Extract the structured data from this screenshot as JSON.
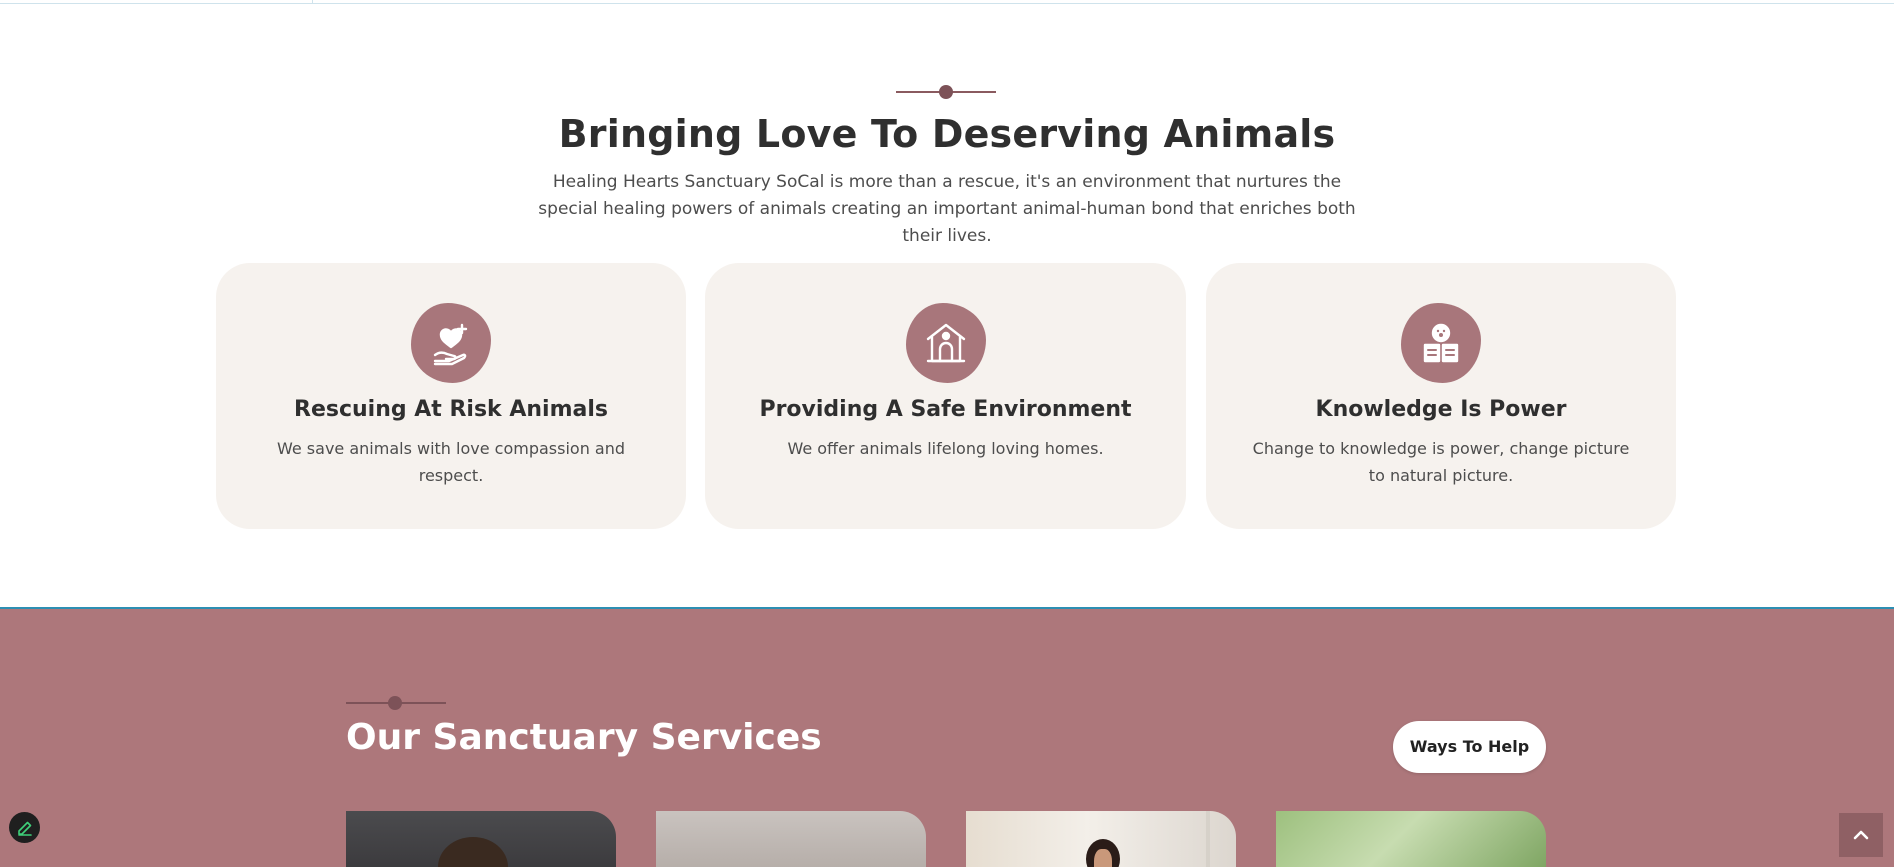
{
  "intro": {
    "title": "Bringing Love To Deserving Animals",
    "description": "Healing Hearts Sanctuary SoCal is more than a rescue, it's an environment that nurtures the special healing powers of animals creating an important animal-human bond that enriches both their lives."
  },
  "cards": [
    {
      "icon": "heart-hand-icon",
      "title": "Rescuing At Risk Animals",
      "text": "We save animals with love compassion and respect."
    },
    {
      "icon": "doghouse-icon",
      "title": "Providing A Safe Environment",
      "text": "We offer animals lifelong loving homes."
    },
    {
      "icon": "paw-book-icon",
      "title": "Knowledge Is Power",
      "text": "Change to knowledge is power, change picture to natural picture."
    }
  ],
  "services": {
    "title": "Our Sanctuary Services",
    "button_label": "Ways To Help"
  },
  "colors": {
    "accent": "#ad777b",
    "icon_blob": "#a8767b",
    "card_bg": "#f6f2ee",
    "divider": "#7d5258"
  }
}
